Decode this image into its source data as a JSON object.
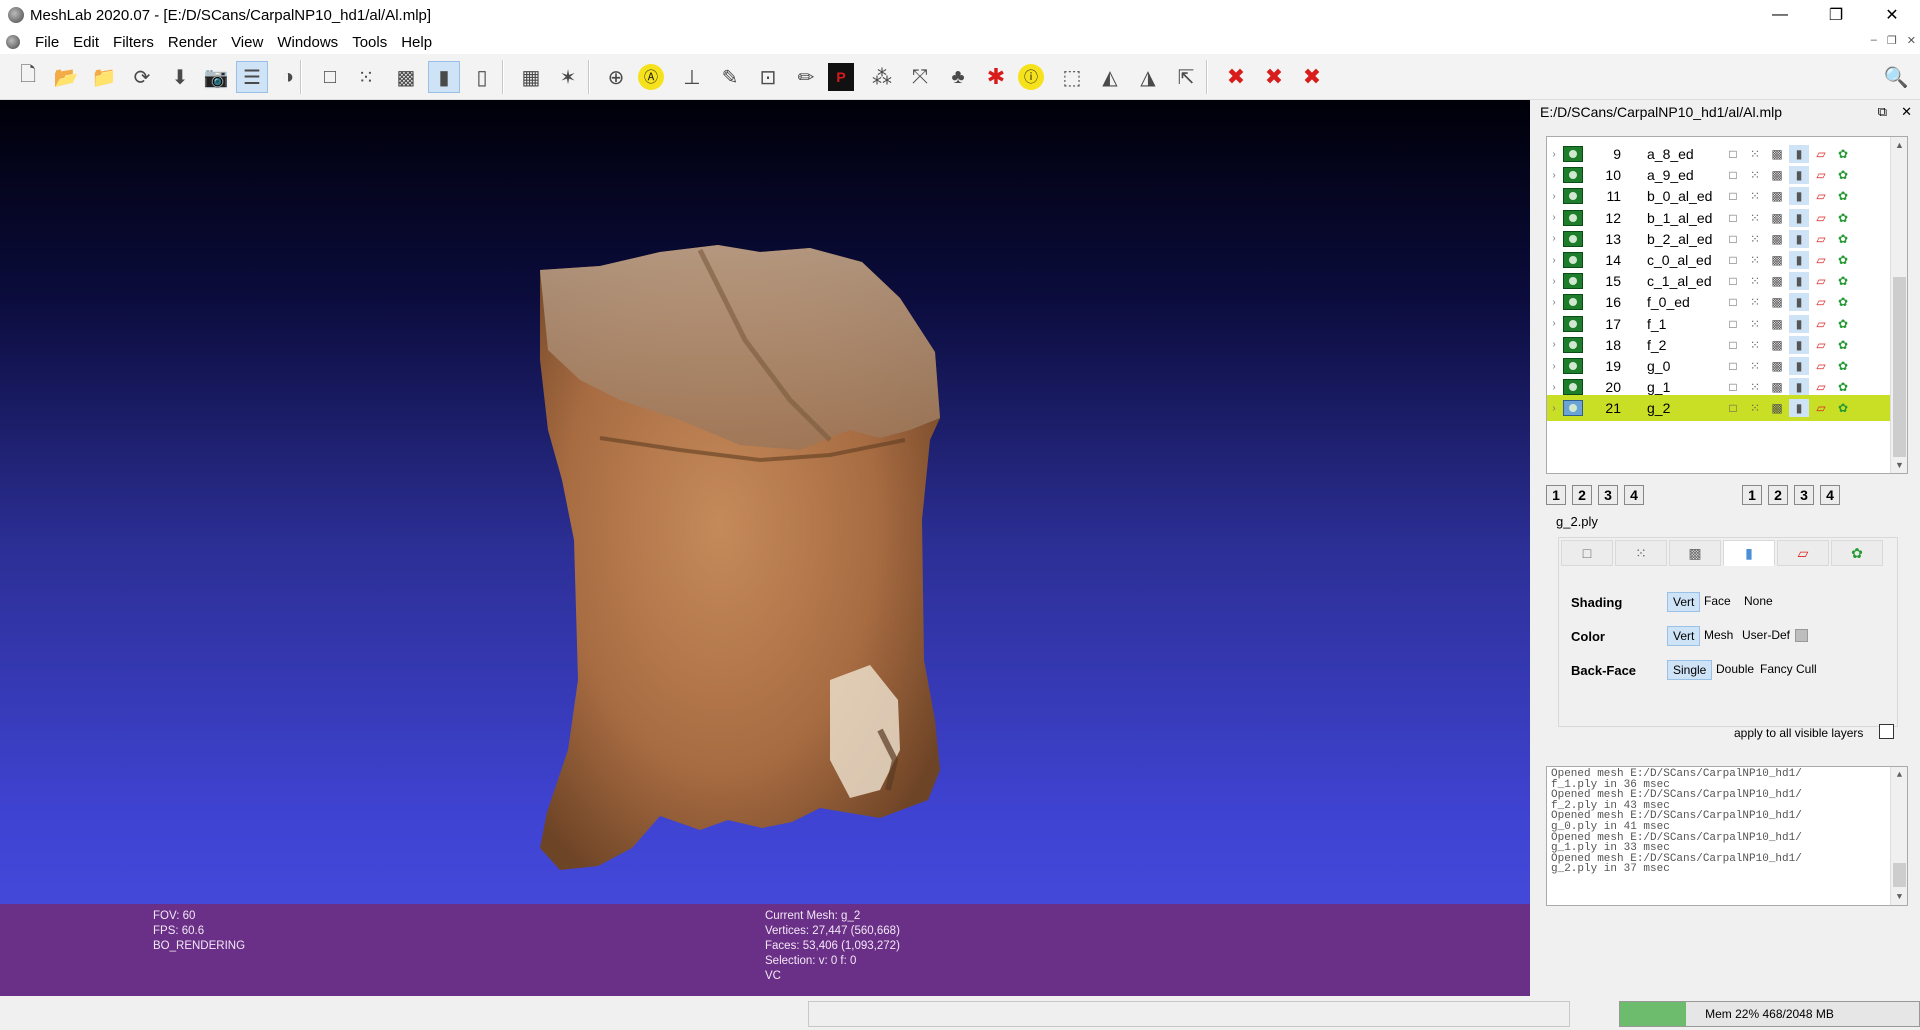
{
  "window": {
    "title": "MeshLab 2020.07 - [E:/D/SCans/CarpalNP10_hd1/al/Al.mlp]",
    "minimize": "—",
    "restore": "❐",
    "close": "✕"
  },
  "menu": [
    "File",
    "Edit",
    "Filters",
    "Render",
    "View",
    "Windows",
    "Tools",
    "Help"
  ],
  "toolbar": [
    {
      "name": "new-project-icon",
      "glyph": "🗋"
    },
    {
      "name": "open-project-icon",
      "glyph": "📂"
    },
    {
      "name": "import-mesh-icon",
      "glyph": "📁"
    },
    {
      "name": "reload-icon",
      "glyph": "⟳"
    },
    {
      "name": "export-mesh-icon",
      "glyph": "⬇"
    },
    {
      "name": "snapshot-icon",
      "glyph": "📷"
    },
    {
      "name": "layers-icon",
      "glyph": "☰",
      "on": true
    },
    {
      "name": "raster-icon",
      "glyph": "◑"
    },
    {
      "name": "bbox-icon",
      "glyph": "□"
    },
    {
      "name": "points-icon",
      "glyph": "⁙"
    },
    {
      "name": "wireframe-icon",
      "glyph": "▩"
    },
    {
      "name": "flat-lines-icon",
      "glyph": "▮",
      "on": true
    },
    {
      "name": "smooth-icon",
      "glyph": "▯"
    },
    {
      "name": "lighting-icon",
      "glyph": "▦"
    },
    {
      "name": "axis-icon",
      "glyph": "✶"
    },
    {
      "name": "trackball-icon",
      "glyph": "⊕"
    },
    {
      "name": "annotation-icon",
      "glyph": "Ⓐ"
    },
    {
      "name": "measure-icon",
      "glyph": "⊥"
    },
    {
      "name": "paint-brush-icon",
      "glyph": "✎"
    },
    {
      "name": "raster-align-icon",
      "glyph": "⊡"
    },
    {
      "name": "pencil-icon",
      "glyph": "✏"
    },
    {
      "name": "point-picker-icon",
      "glyph": "P"
    },
    {
      "name": "select-vertices-icon",
      "glyph": "⁂"
    },
    {
      "name": "manipulator-icon",
      "glyph": "⤧"
    },
    {
      "name": "z-paint-icon",
      "glyph": "♣"
    },
    {
      "name": "georef-icon",
      "glyph": "✱"
    },
    {
      "name": "info-icon",
      "glyph": "ⓘ"
    },
    {
      "name": "select-rect-icon",
      "glyph": "⬚"
    },
    {
      "name": "select-faces-icon",
      "glyph": "◭"
    },
    {
      "name": "select-connected-icon",
      "glyph": "◮"
    },
    {
      "name": "select-pointer-icon",
      "glyph": "⇱"
    },
    {
      "name": "delete-vertices-icon",
      "glyph": "✖"
    },
    {
      "name": "delete-faces-icon",
      "glyph": "✖"
    },
    {
      "name": "delete-faces-vertices-icon",
      "glyph": "✖"
    }
  ],
  "search_icon": "🔍",
  "info_left": [
    "FOV: 60",
    "FPS:   60.6",
    "BO_RENDERING"
  ],
  "info_right": [
    "Current Mesh: g_2",
    "Vertices: 27,447    (560,668)",
    "Faces: 53,406    (1,093,272)",
    "Selection: v: 0 f: 0",
    "VC"
  ],
  "panel": {
    "path": "E:/D/SCans/CarpalNP10_hd1/al/Al.mlp",
    "float": "⧉",
    "close": "✕"
  },
  "layers": [
    {
      "num": "9",
      "name": "a_8_ed"
    },
    {
      "num": "10",
      "name": "a_9_ed"
    },
    {
      "num": "11",
      "name": "b_0_al_ed"
    },
    {
      "num": "12",
      "name": "b_1_al_ed"
    },
    {
      "num": "13",
      "name": "b_2_al_ed"
    },
    {
      "num": "14",
      "name": "c_0_al_ed"
    },
    {
      "num": "15",
      "name": "c_1_al_ed"
    },
    {
      "num": "16",
      "name": "f_0_ed"
    },
    {
      "num": "17",
      "name": "f_1"
    },
    {
      "num": "18",
      "name": "f_2"
    },
    {
      "num": "19",
      "name": "g_0"
    },
    {
      "num": "20",
      "name": "g_1"
    },
    {
      "num": "21",
      "name": "g_2",
      "selected": true
    }
  ],
  "row_icons": [
    "□",
    "⁙",
    "▩",
    "▮",
    "▱",
    "✿"
  ],
  "num_buttons_left": [
    "1",
    "2",
    "3",
    "4"
  ],
  "num_buttons_right": [
    "1",
    "2",
    "3",
    "4"
  ],
  "mesh_name": "g_2.ply",
  "render_tabs": [
    "□",
    "⁙",
    "▩",
    "▮",
    "▱",
    "✿"
  ],
  "shading": {
    "label": "Shading",
    "options": [
      "Vert",
      "Face",
      "None"
    ],
    "selected": "Vert"
  },
  "color": {
    "label": "Color",
    "options": [
      "Vert",
      "Mesh",
      "User-Def"
    ],
    "selected": "Vert"
  },
  "backface": {
    "label": "Back-Face",
    "options": [
      "Single",
      "Double",
      "Fancy",
      "Cull"
    ],
    "selected": "Single"
  },
  "apply_all": "apply to all visible layers",
  "log": [
    "Opened mesh E:/D/SCans/CarpalNP10_hd1/",
    "f_1.ply in 36 msec",
    "Opened mesh E:/D/SCans/CarpalNP10_hd1/",
    "f_2.ply in 43 msec",
    "Opened mesh E:/D/SCans/CarpalNP10_hd1/",
    "g_0.ply in 41 msec",
    "Opened mesh E:/D/SCans/CarpalNP10_hd1/",
    "g_1.ply in 33 msec",
    "Opened mesh E:/D/SCans/CarpalNP10_hd1/",
    "g_2.ply in 37 msec"
  ],
  "memory": {
    "label": "Mem 22% 468/2048 MB",
    "percent": 22
  }
}
